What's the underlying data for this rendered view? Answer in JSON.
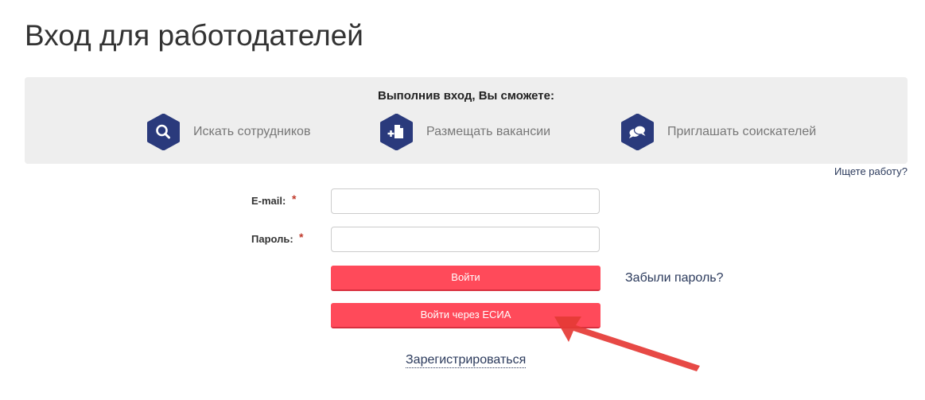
{
  "page": {
    "title": "Вход для работодателей"
  },
  "benefits": {
    "heading": "Выполнив вход, Вы сможете:",
    "items": [
      {
        "icon": "search-icon",
        "label": "Искать сотрудников"
      },
      {
        "icon": "add-document-icon",
        "label": "Размещать вакансии"
      },
      {
        "icon": "chat-bubbles-icon",
        "label": "Приглашать соискателей"
      }
    ]
  },
  "job_seeker_link": "Ищете работу?",
  "form": {
    "email_label": "E-mail:",
    "password_label": "Пароль:",
    "required_mark": "*",
    "email_value": "",
    "password_value": "",
    "login_button": "Войти",
    "esia_button": "Войти через ЕСИА",
    "forgot_link": "Забыли пароль?",
    "register_link": "Зарегистрироваться"
  },
  "colors": {
    "icon_hex": "#2a3a7c",
    "button": "#ff4a5a",
    "link": "#2b3a5c",
    "arrow": "#e53935",
    "panel": "#eeeeee"
  }
}
